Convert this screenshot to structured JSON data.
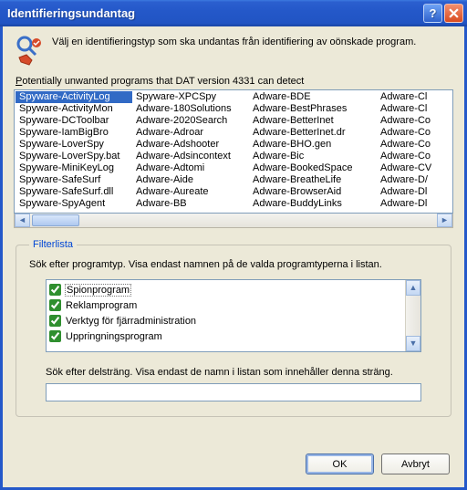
{
  "window": {
    "title": "Identifieringsundantag"
  },
  "header": {
    "text": "Välj en identifieringstyp som ska undantas från identifiering av oönskade program."
  },
  "list_label_pre": "P",
  "list_label_rest": "otentially unwanted programs that DAT version 4331 can detect",
  "programs": {
    "col1": [
      "Spyware-ActivityLog",
      "Spyware-ActivityMon",
      "Spyware-DCToolbar",
      "Spyware-IamBigBro",
      "Spyware-LoverSpy",
      "Spyware-LoverSpy.bat",
      "Spyware-MiniKeyLog",
      "Spyware-SafeSurf",
      "Spyware-SafeSurf.dll",
      "Spyware-SpyAgent"
    ],
    "col2": [
      "Spyware-XPCSpy",
      "Adware-180Solutions",
      "Adware-2020Search",
      "Adware-Adroar",
      "Adware-Adshooter",
      "Adware-Adsincontext",
      "Adware-Adtomi",
      "Adware-Aide",
      "Adware-Aureate",
      "Adware-BB"
    ],
    "col3": [
      "Adware-BDE",
      "Adware-BestPhrases",
      "Adware-BetterInet",
      "Adware-BetterInet.dr",
      "Adware-BHO.gen",
      "Adware-Bic",
      "Adware-BookedSpace",
      "Adware-BreatheLife",
      "Adware-BrowserAid",
      "Adware-BuddyLinks"
    ],
    "col4": [
      "Adware-Cl",
      "Adware-Cl",
      "Adware-Co",
      "Adware-Co",
      "Adware-Co",
      "Adware-Co",
      "Adware-CV",
      "Adware-D/",
      "Adware-Dl",
      "Adware-Dl"
    ]
  },
  "selected_program_index": 0,
  "filter": {
    "legend": "Filterlista",
    "desc": "Sök efter programtyp. Visa endast namnen på de valda programtyperna i listan.",
    "items": [
      {
        "label": "Spionprogram",
        "checked": true
      },
      {
        "label": "Reklamprogram",
        "checked": true
      },
      {
        "label": "Verktyg för fjärradministration",
        "checked": true
      },
      {
        "label": "Uppringningsprogram",
        "checked": true
      }
    ],
    "substring_label": "Sök efter delsträng. Visa endast de namn i listan som innehåller denna sträng.",
    "substring_value": ""
  },
  "buttons": {
    "ok": "OK",
    "cancel": "Avbryt"
  }
}
